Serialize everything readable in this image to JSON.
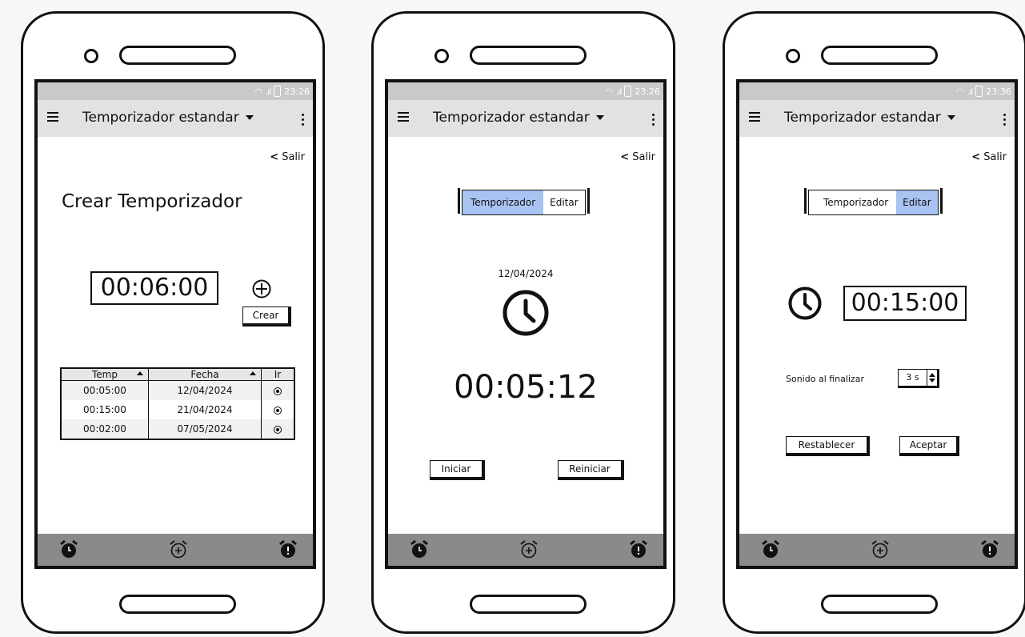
{
  "status": {
    "time_1": "23:26",
    "time_2": "23:26",
    "time_3": "23:36"
  },
  "appbar": {
    "title": "Temporizador estandar"
  },
  "salir_label": "Salir",
  "screen1": {
    "heading": "Crear Temporizador",
    "timer_value": "00:06:00",
    "crear_label": "Crear",
    "table": {
      "columns": [
        "Temp",
        "Fecha",
        "Ir"
      ],
      "rows": [
        [
          "00:05:00",
          "12/04/2024"
        ],
        [
          "00:15:00",
          "21/04/2024"
        ],
        [
          "00:02:00",
          "07/05/2024"
        ]
      ]
    }
  },
  "screen2": {
    "tabs": [
      "Temporizador",
      "Editar"
    ],
    "active_tab": "Temporizador",
    "date": "12/04/2024",
    "countdown": "00:05:12",
    "iniciar_label": "Iniciar",
    "reiniciar_label": "Reiniciar"
  },
  "screen3": {
    "tabs": [
      "Temporizador",
      "Editar"
    ],
    "active_tab": "Editar",
    "timer_value": "00:15:00",
    "sound_label": "Sonido al finalizar",
    "sound_value": "3 s",
    "restablecer_label": "Restablecer",
    "aceptar_label": "Aceptar"
  },
  "icons": {
    "menu": "hamburger-icon",
    "more": "kebab-icon",
    "back": "chevron-left-icon",
    "add": "plus-circle-icon",
    "clock": "clock-icon",
    "nav": [
      "alarm-icon",
      "alarm-add-icon",
      "alarm-alert-icon"
    ]
  },
  "colors": {
    "active_tab": "#a9c4f2",
    "appbar": "#e2e2e2",
    "statusbar": "#c9c9c9",
    "bottomnav": "#8a8a8a"
  }
}
